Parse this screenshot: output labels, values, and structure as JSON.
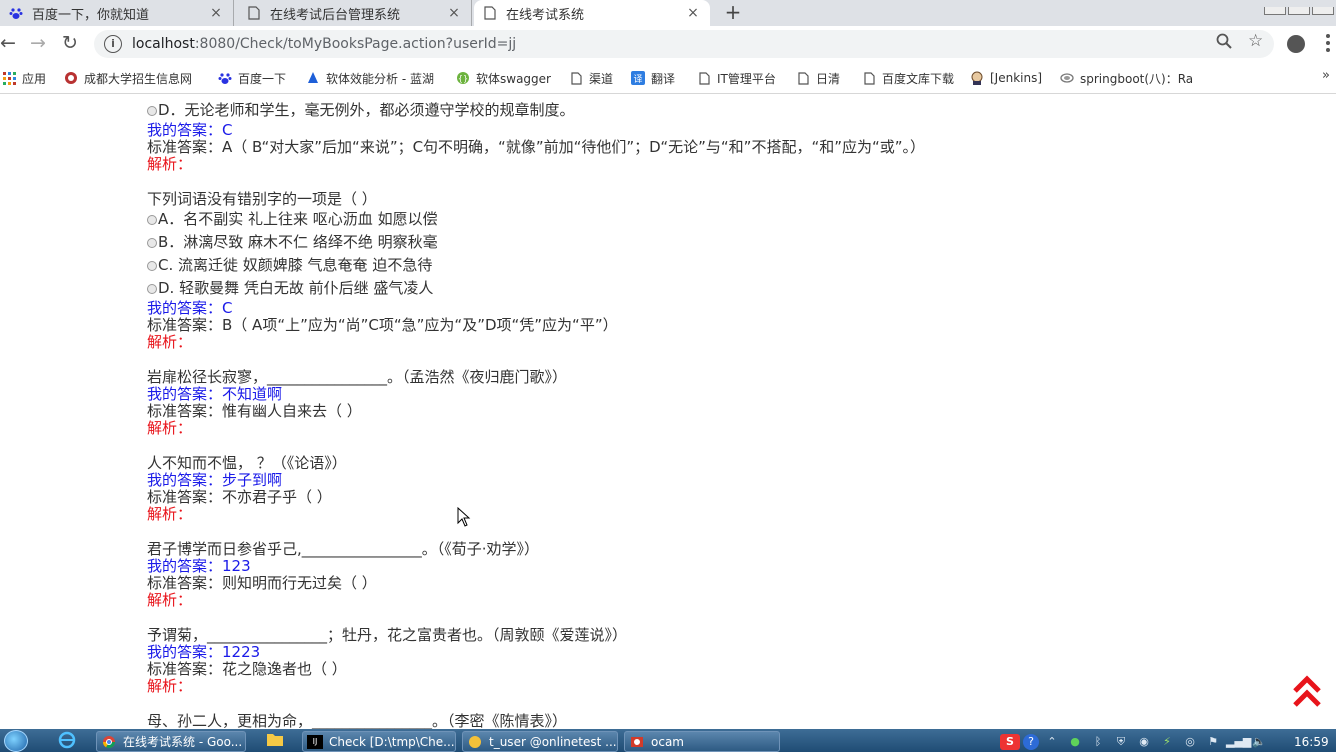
{
  "tabs": [
    {
      "title": "百度一下，你就知道",
      "close": "×"
    },
    {
      "title": "在线考试后台管理系统",
      "close": "×"
    },
    {
      "title": "在线考试系统",
      "close": "×"
    }
  ],
  "new_tab": "+",
  "address": {
    "host": "localhost",
    "path": ":8080/Check/toMyBooksPage.action?userId=jj"
  },
  "bookmarks": [
    {
      "label": "应用",
      "icon": "apps-grid-icon"
    },
    {
      "label": "成都大学招生信息网",
      "icon": "university-icon"
    },
    {
      "label": "百度一下",
      "icon": "baidu-paw-icon"
    },
    {
      "label": "软体效能分析 - 蓝湖",
      "icon": "lanhu-icon"
    },
    {
      "label": "软体swagger",
      "icon": "swagger-icon"
    },
    {
      "label": "渠道",
      "icon": "page-icon"
    },
    {
      "label": "翻译",
      "icon": "translate-icon"
    },
    {
      "label": "IT管理平台",
      "icon": "page-icon"
    },
    {
      "label": "日清",
      "icon": "page-icon"
    },
    {
      "label": "百度文库下载",
      "icon": "page-icon"
    },
    {
      "label": "[Jenkins]",
      "icon": "jenkins-icon"
    },
    {
      "label": "springboot(八)：Ra",
      "icon": "springboot-icon"
    }
  ],
  "bookmarks_more": "»",
  "questions": [
    {
      "options": [
        "D．无论老师和学生，毫无例外，都必须遵守学校的规章制度。"
      ],
      "my_answer": "我的答案：C",
      "standard": "标准答案：A（ B“对大家”后加“来说”；C句不明确，“就像”前加“待他们”；D“无论”与“和”不搭配，“和”应为“或”。）",
      "analysis": "解析："
    },
    {
      "stem": "下列词语没有错别字的一项是（   ）",
      "options": [
        "A．名不副实 礼上往来 呕心沥血 如愿以偿",
        "B．淋漓尽致 麻木不仁 络绎不绝 明察秋毫",
        "C. 流离迁徙 奴颜婢膝 气息奄奄 迫不急待",
        "D. 轻歌曼舞 凭白无故 前仆后继 盛气凌人"
      ],
      "my_answer": "我的答案：C",
      "standard": "标准答案：B（ A项“上”应为“尚”C项“急”应为“及”D项“凭”应为“平”）",
      "analysis": "解析："
    },
    {
      "stem": "岩扉松径长寂寥，________________。（孟浩然《夜归鹿门歌》）",
      "my_answer": "我的答案：不知道啊",
      "standard": "标准答案：惟有幽人自来去（   ）",
      "analysis": "解析："
    },
    {
      "stem": "人不知而不愠，   ？（《论语》）",
      "my_answer": "我的答案：步子到啊",
      "standard": "标准答案：不亦君子乎（   ）",
      "analysis": "解析："
    },
    {
      "stem": "君子博学而日参省乎己,________________。（《荀子·劝学》）",
      "my_answer": "我的答案：123",
      "standard": "标准答案：则知明而行无过矣（   ）",
      "analysis": "解析："
    },
    {
      "stem": "予谓菊，________________；牡丹，花之富贵者也。（周敦颐《爱莲说》）",
      "my_answer": "我的答案：1223",
      "standard": "标准答案：花之隐逸者也（   ）",
      "analysis": "解析："
    },
    {
      "stem": "母、孙二人，更相为命，________________。（李密《陈情表》）"
    }
  ],
  "taskbar": {
    "buttons": [
      {
        "label": "在线考试系统 - Goo...",
        "icon": "chrome-icon"
      },
      {
        "label": "Check [D:\\tmp\\Che...",
        "icon": "intellij-icon"
      },
      {
        "label": "t_user @onlinetest ...",
        "icon": "database-icon"
      },
      {
        "label": "ocam",
        "icon": "ocam-icon"
      }
    ],
    "clock": "16:59"
  }
}
